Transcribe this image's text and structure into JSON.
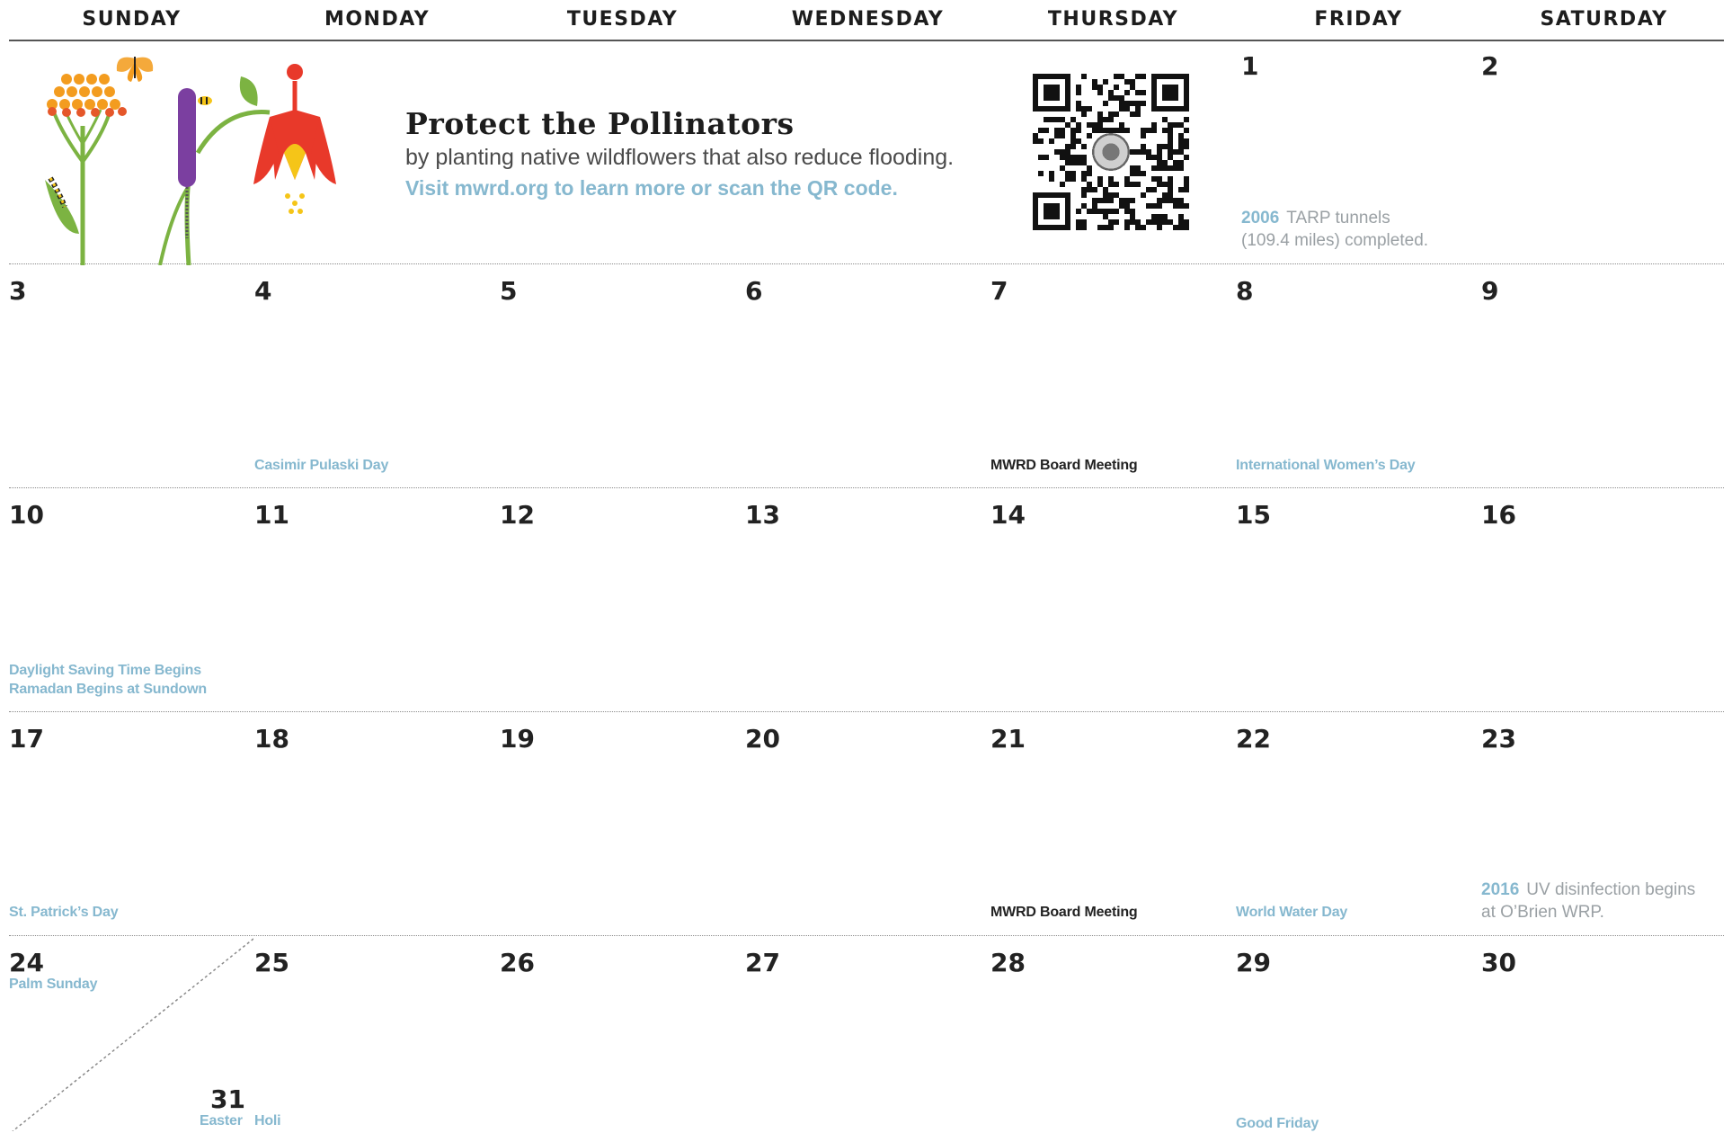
{
  "weekdays": [
    "SUNDAY",
    "MONDAY",
    "TUESDAY",
    "WEDNESDAY",
    "THURSDAY",
    "FRIDAY",
    "SATURDAY"
  ],
  "promo": {
    "title": "Protect the Pollinators",
    "subtitle": "by planting native wildflowers that also reduce flooding.",
    "link": "Visit mwrd.org to learn more or scan the QR code."
  },
  "days": {
    "d1": "1",
    "d2": "2",
    "d3": "3",
    "d4": "4",
    "d5": "5",
    "d6": "6",
    "d7": "7",
    "d8": "8",
    "d9": "9",
    "d10": "10",
    "d11": "11",
    "d12": "12",
    "d13": "13",
    "d14": "14",
    "d15": "15",
    "d16": "16",
    "d17": "17",
    "d18": "18",
    "d19": "19",
    "d20": "20",
    "d21": "21",
    "d22": "22",
    "d23": "23",
    "d24": "24",
    "d25": "25",
    "d26": "26",
    "d27": "27",
    "d28": "28",
    "d29": "29",
    "d30": "30",
    "d31": "31"
  },
  "events": {
    "casimir": "Casimir Pulaski Day",
    "board1": "MWRD Board Meeting",
    "womens": "International Women’s Day",
    "dst": "Daylight Saving Time Begins",
    "ramadan": "Ramadan Begins at Sundown",
    "patrick": "St. Patrick’s Day",
    "board2": "MWRD Board Meeting",
    "water": "World Water Day",
    "palm": "Palm Sunday",
    "easter": "Easter",
    "holi": "Holi",
    "goodfriday": "Good Friday"
  },
  "history": {
    "h1_year": "2006",
    "h1_l1": "TARP tunnels",
    "h1_l2": "(109.4 miles) completed.",
    "h2_year": "2016",
    "h2_l1": "UV disinfection begins",
    "h2_l2": "at O’Brien WRP."
  },
  "colors": {
    "accent": "#86b8cf",
    "text": "#1d1d1d",
    "history": "#9aa0a4"
  }
}
